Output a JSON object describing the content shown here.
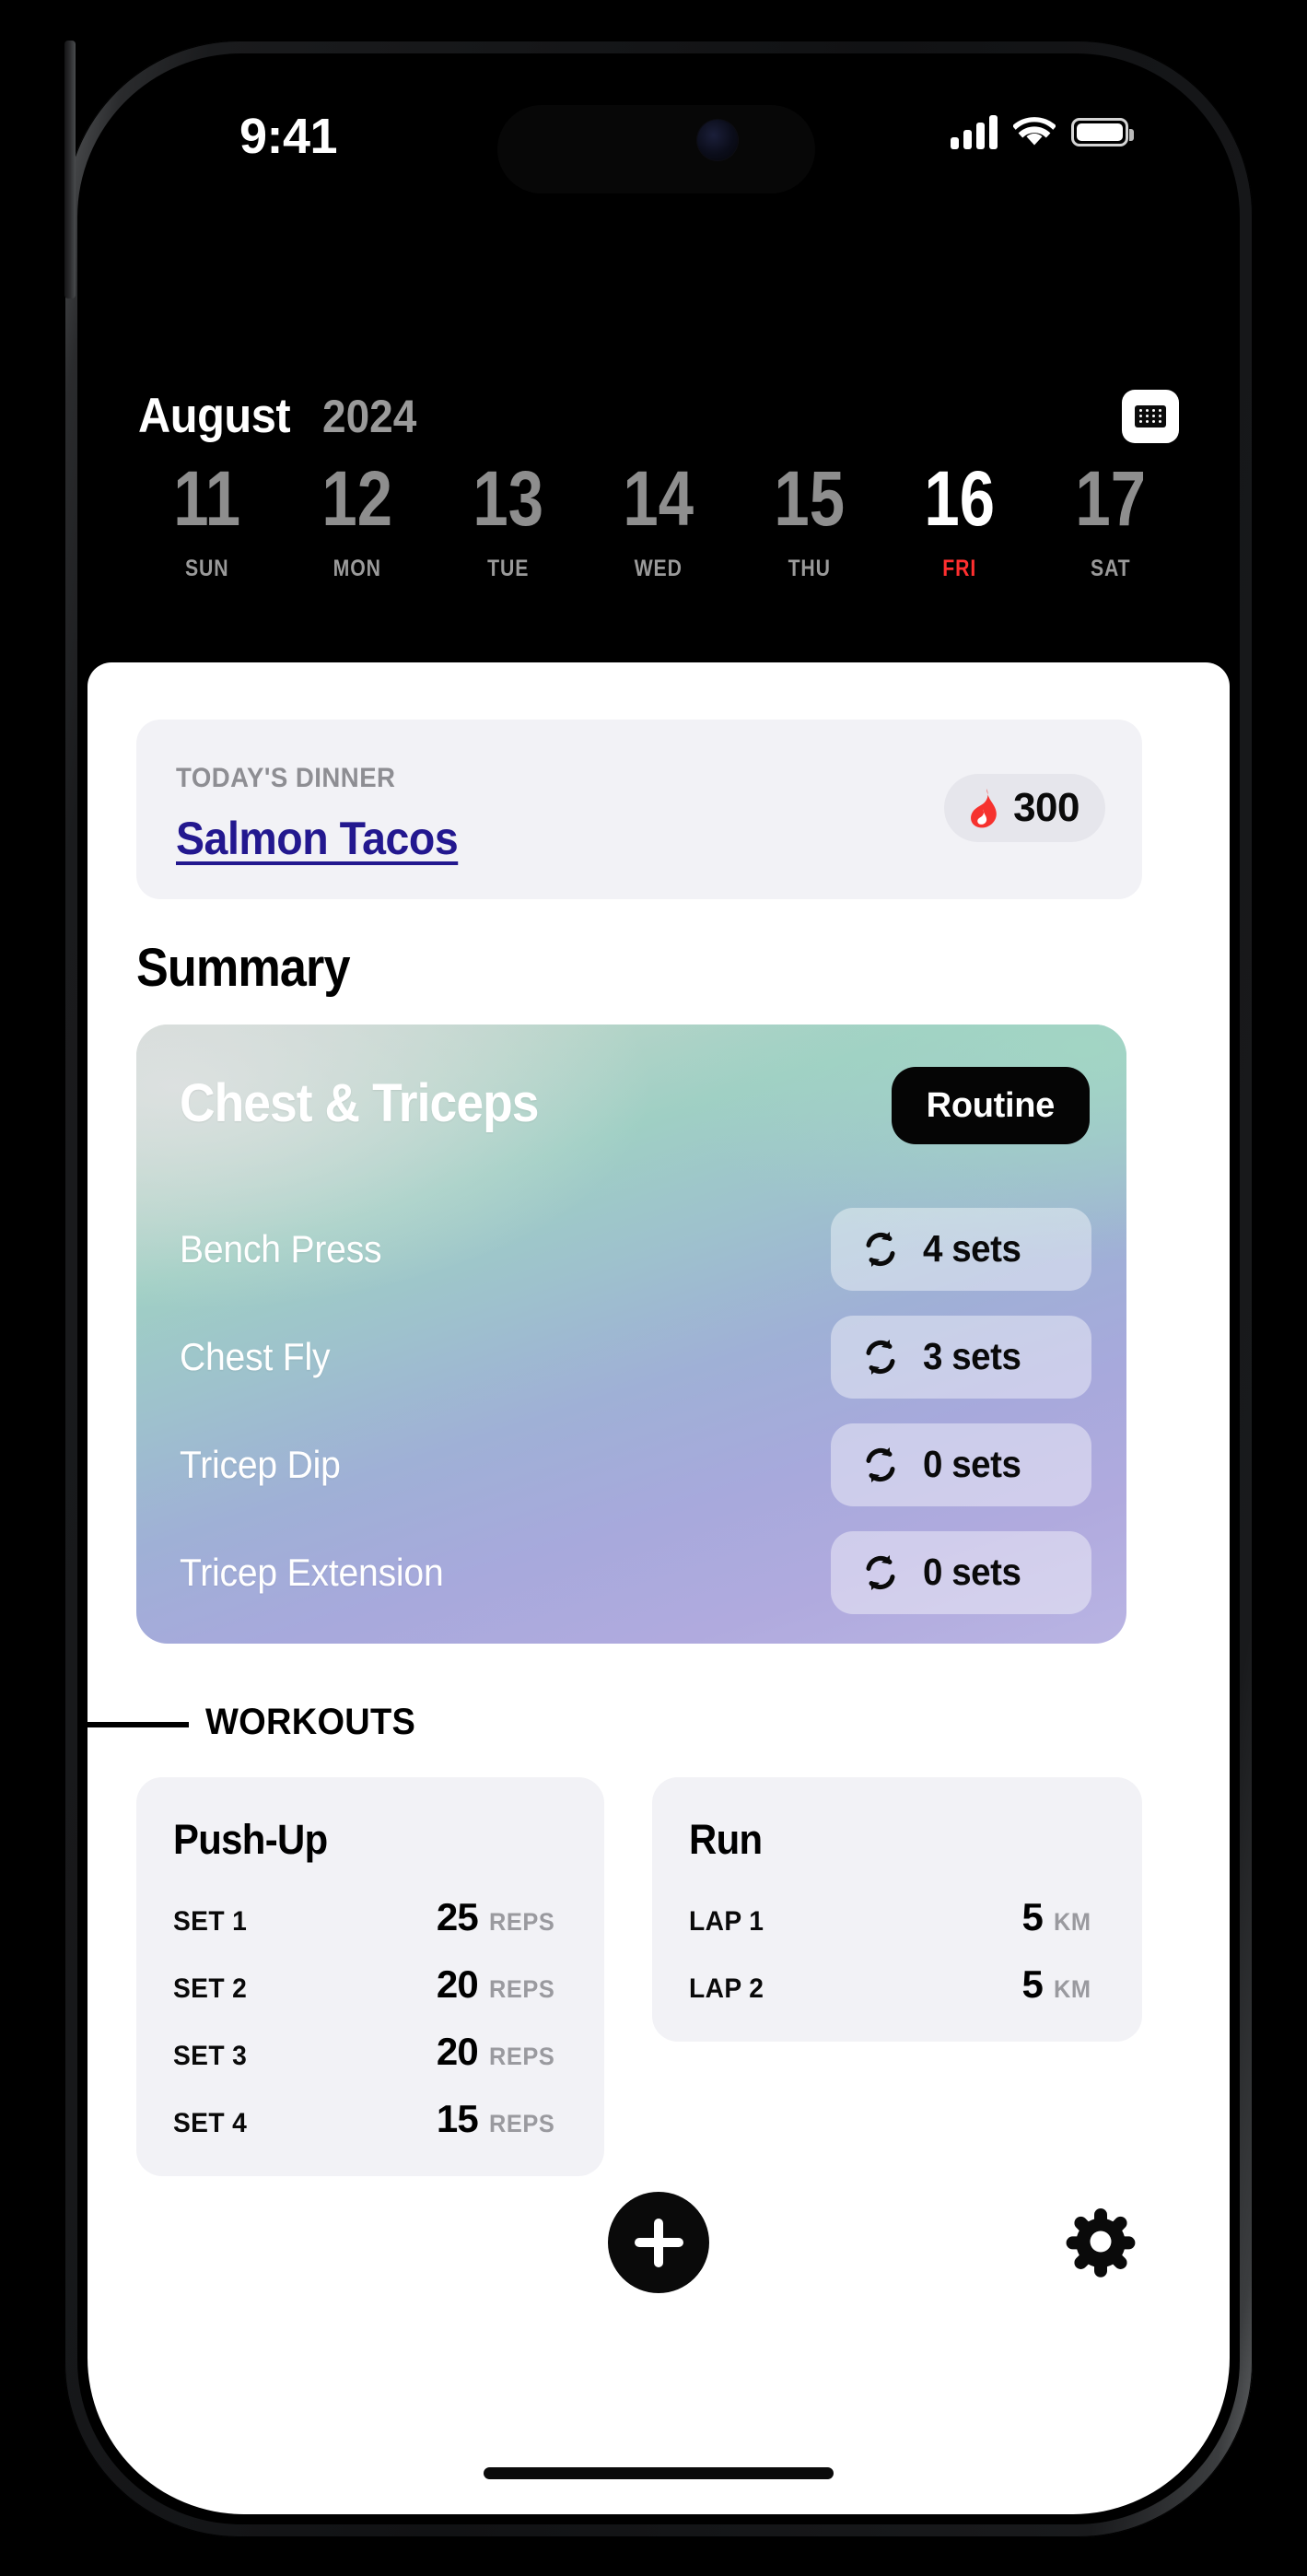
{
  "status_bar": {
    "time": "9:41",
    "icons": [
      "cellular-signal-icon",
      "wifi-icon",
      "battery-icon"
    ]
  },
  "header": {
    "month": "August",
    "year": "2024",
    "calendar_button_icon": "calendar-icon",
    "week": [
      {
        "date": "11",
        "day": "SUN",
        "active": false
      },
      {
        "date": "12",
        "day": "MON",
        "active": false
      },
      {
        "date": "13",
        "day": "TUE",
        "active": false
      },
      {
        "date": "14",
        "day": "WED",
        "active": false
      },
      {
        "date": "15",
        "day": "THU",
        "active": false
      },
      {
        "date": "16",
        "day": "FRI",
        "active": true
      },
      {
        "date": "17",
        "day": "SAT",
        "active": false
      }
    ],
    "active_day_color": "#ff2f2f"
  },
  "dinner": {
    "label": "TODAY'S DINNER",
    "name": "Salmon Tacos",
    "name_color": "#23188f",
    "calories": "300",
    "calorie_icon": "flame-icon",
    "flame_color": "#f6322e"
  },
  "summary": {
    "heading": "Summary",
    "routine": {
      "title": "Chest & Triceps",
      "badge": "Routine",
      "exercises": [
        {
          "name": "Bench Press",
          "sets": "4 sets",
          "icon": "repeat-icon"
        },
        {
          "name": "Chest Fly",
          "sets": "3 sets",
          "icon": "repeat-icon"
        },
        {
          "name": "Tricep Dip",
          "sets": "0 sets",
          "icon": "repeat-icon"
        },
        {
          "name": "Tricep Extension",
          "sets": "0 sets",
          "icon": "repeat-icon"
        }
      ]
    }
  },
  "workouts": {
    "section_label": "WORKOUTS",
    "cards": [
      {
        "title": "Push-Up",
        "rows": [
          {
            "key": "SET 1",
            "value": "25",
            "unit": "REPS"
          },
          {
            "key": "SET 2",
            "value": "20",
            "unit": "REPS"
          },
          {
            "key": "SET 3",
            "value": "20",
            "unit": "REPS"
          },
          {
            "key": "SET 4",
            "value": "15",
            "unit": "REPS"
          }
        ]
      },
      {
        "title": "Run",
        "rows": [
          {
            "key": "LAP 1",
            "value": "5",
            "unit": "KM"
          },
          {
            "key": "LAP 2",
            "value": "5",
            "unit": "KM"
          }
        ]
      }
    ]
  },
  "bottom_bar": {
    "add_button_icon": "plus-icon",
    "settings_icon": "gear-icon"
  }
}
